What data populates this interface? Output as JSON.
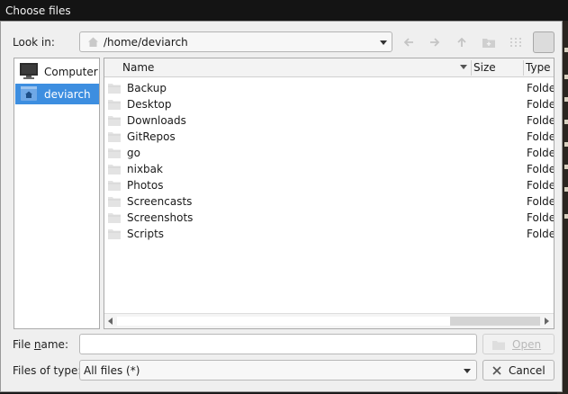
{
  "window": {
    "title": "Choose files"
  },
  "look_in": {
    "label": "Look in:",
    "path": "/home/deviarch"
  },
  "toolbar": {
    "back_icon": "arrow-left-icon",
    "forward_icon": "arrow-right-icon",
    "up_icon": "arrow-up-icon",
    "new_folder_icon": "new-folder-icon",
    "list_view_icon": "list-view-icon",
    "detail_view_icon": "detail-view-icon"
  },
  "sidebar": {
    "items": [
      {
        "label": "Computer",
        "icon": "monitor-icon",
        "selected": false
      },
      {
        "label": "deviarch",
        "icon": "home-folder-icon",
        "selected": true
      }
    ]
  },
  "file_list": {
    "columns": [
      "Name",
      "Size",
      "Type"
    ],
    "rows": [
      {
        "name": "Backup",
        "type": "Folder"
      },
      {
        "name": "Desktop",
        "type": "Folder"
      },
      {
        "name": "Downloads",
        "type": "Folder"
      },
      {
        "name": "GitRepos",
        "type": "Folder"
      },
      {
        "name": "go",
        "type": "Folder"
      },
      {
        "name": "nixbak",
        "type": "Folder"
      },
      {
        "name": "Photos",
        "type": "Folder"
      },
      {
        "name": "Screencasts",
        "type": "Folder"
      },
      {
        "name": "Screenshots",
        "type": "Folder"
      },
      {
        "name": "Scripts",
        "type": "Folder"
      }
    ]
  },
  "file_name": {
    "label_pre": "File ",
    "label_mnemonic": "n",
    "label_post": "ame:",
    "value": ""
  },
  "file_type": {
    "label": "Files of type:",
    "selected": "All files (*)"
  },
  "buttons": {
    "open": "Open",
    "cancel": "Cancel"
  },
  "colors": {
    "selection": "#3d8ee0",
    "folder": "#e3e3e3"
  }
}
